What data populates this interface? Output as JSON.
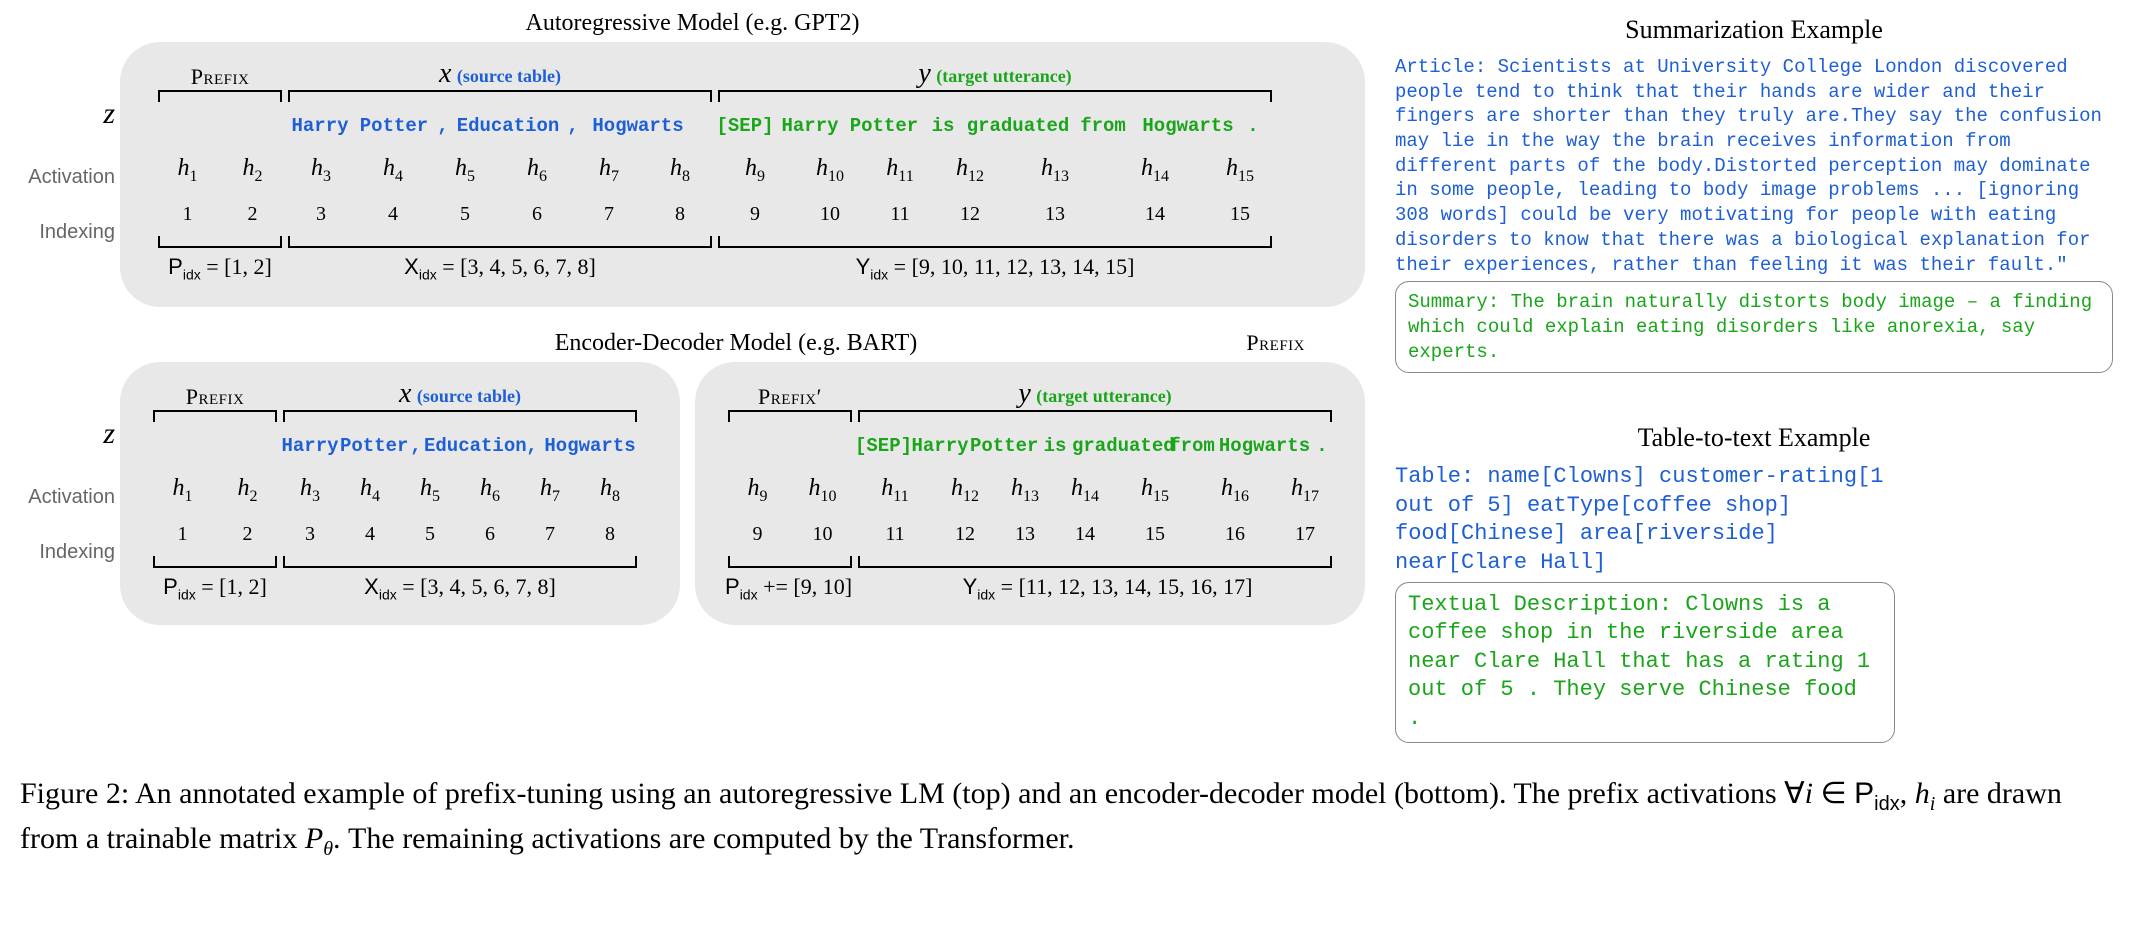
{
  "top": {
    "title": "Autoregressive Model  (e.g. GPT2)",
    "headers": {
      "prefix": "Prefix",
      "x": "x",
      "x_anno": " (source table)",
      "y": "y",
      "y_anno": " (target utterance)"
    },
    "z_label": "z",
    "act_label": "Activation",
    "idx_label": "Indexing",
    "tokens_x": [
      "Harry",
      "Potter",
      ",",
      "Education",
      ",",
      "Hogwarts"
    ],
    "sep": "[SEP]",
    "tokens_y": [
      "Harry",
      "Potter",
      "is",
      "graduated",
      "from",
      "Hogwarts",
      "."
    ],
    "h": [
      "h₁",
      "h₂",
      "h₃",
      "h₄",
      "h₅",
      "h₆",
      "h₇",
      "h₈",
      "h₉",
      "h₁₀",
      "h₁₁",
      "h₁₂",
      "h₁₃",
      "h₁₄",
      "h₁₅"
    ],
    "idx": [
      "1",
      "2",
      "3",
      "4",
      "5",
      "6",
      "7",
      "8",
      "9",
      "10",
      "11",
      "12",
      "13",
      "14",
      "15"
    ],
    "p_idx": "Pidx = [1, 2]",
    "x_idx": "Xidx = [3, 4, 5, 6, 7, 8]",
    "y_idx": "Yidx = [9, 10, 11, 12, 13, 14, 15]"
  },
  "bottom": {
    "title": "Encoder-Decoder Model  (e.g. BART)",
    "prefix2_top": "Prefix",
    "headers_enc": {
      "prefix": "Prefix",
      "x": "x",
      "x_anno": " (source table)"
    },
    "headers_dec": {
      "prefix": "Prefix′",
      "y": "y",
      "y_anno": " (target utterance)"
    },
    "tokens_x": [
      "Harry",
      "Potter",
      ",",
      "Education",
      ",",
      "Hogwarts"
    ],
    "sep": "[SEP]",
    "tokens_y": [
      "Harry",
      "Potter",
      "is",
      "graduated",
      "from",
      "Hogwarts",
      "."
    ],
    "h_enc": [
      "h₁",
      "h₂",
      "h₃",
      "h₄",
      "h₅",
      "h₆",
      "h₇",
      "h₈"
    ],
    "h_dec": [
      "h₉",
      "h₁₀",
      "h₁₁",
      "h₁₂",
      "h₁₃",
      "h₁₄",
      "h₁₅",
      "h₁₆",
      "h₁₇"
    ],
    "idx_enc": [
      "1",
      "2",
      "3",
      "4",
      "5",
      "6",
      "7",
      "8"
    ],
    "idx_dec": [
      "9",
      "10",
      "11",
      "12",
      "13",
      "14",
      "15",
      "16",
      "17"
    ],
    "p_idx": "Pidx = [1, 2]",
    "x_idx": "Xidx = [3, 4, 5, 6, 7, 8]",
    "p_idx2": "Pidx += [9, 10]",
    "y_idx": "Yidx = [11, 12, 13, 14, 15, 16, 17]"
  },
  "summ": {
    "title": "Summarization Example",
    "article": "Article: Scientists at University College London discovered people tend to think that their hands are wider and their fingers are shorter than they truly are.They say the confusion may lie in the way the brain receives information from different parts of the body.Distorted perception may dominate in some people, leading to body image problems ... [ignoring 308 words] could be very motivating for people with eating disorders to know that there was a biological explanation for their experiences, rather than feeling it was their fault.\"",
    "summary": "Summary: The brain naturally distorts body image – a finding which could explain eating disorders like anorexia, say experts."
  },
  "t2t": {
    "title": "Table-to-text Example",
    "table": "Table:   name[Clowns] customer-rating[1 out of 5]  eatType[coffee shop] food[Chinese] area[riverside] near[Clare Hall]",
    "desc": "Textual Description: Clowns is a coffee shop in the riverside area near Clare Hall that has a rating 1 out of 5 . They serve Chinese food ."
  },
  "caption": {
    "pre": "Figure 2:  An annotated example of prefix-tuning using an autoregressive LM (top) and an encoder-decoder model (bottom). The prefix activations ",
    "math": "∀i ∈ Pidx, hi",
    "mid": " are drawn from a trainable matrix ",
    "ptheta": "Pθ",
    "post": ". The remaining activations are computed by the Transformer."
  }
}
